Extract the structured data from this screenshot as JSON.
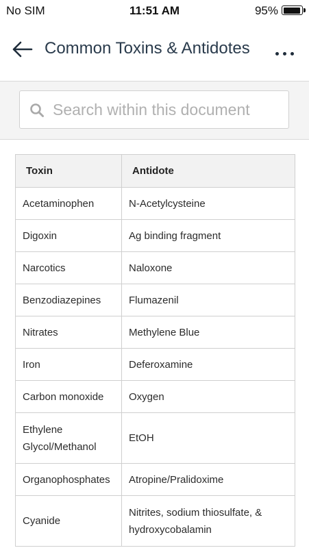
{
  "status_bar": {
    "carrier": "No SIM",
    "time": "11:51 AM",
    "battery_percent": "95%",
    "battery_level": 0.95
  },
  "header": {
    "title": "Common Toxins & Antidotes",
    "back_icon": "arrow-left-icon",
    "more_icon": "more-horizontal-icon"
  },
  "search": {
    "placeholder": "Search within this document",
    "value": "",
    "icon": "search-icon"
  },
  "table": {
    "columns": [
      "Toxin",
      "Antidote"
    ],
    "rows": [
      {
        "toxin": "Acetaminophen",
        "antidote": "N-Acetylcysteine"
      },
      {
        "toxin": "Digoxin",
        "antidote": "Ag binding fragment"
      },
      {
        "toxin": "Narcotics",
        "antidote": "Naloxone"
      },
      {
        "toxin": "Benzodiazepines",
        "antidote": "Flumazenil"
      },
      {
        "toxin": "Nitrates",
        "antidote": "Methylene Blue"
      },
      {
        "toxin": "Iron",
        "antidote": "Deferoxamine"
      },
      {
        "toxin": "Carbon monoxide",
        "antidote": "Oxygen"
      },
      {
        "toxin": "Ethylene Glycol/Methanol",
        "antidote": "EtOH"
      },
      {
        "toxin": "Organophosphates",
        "antidote": "Atropine/Pralidoxime"
      },
      {
        "toxin": "Cyanide",
        "antidote": "Nitrites, sodium thiosulfate, & hydroxycobalamin"
      }
    ]
  },
  "colors": {
    "title": "#2a3b4c",
    "border": "#cfcfcf",
    "header_bg": "#f2f2f2",
    "search_bg": "#f4f4f4"
  }
}
